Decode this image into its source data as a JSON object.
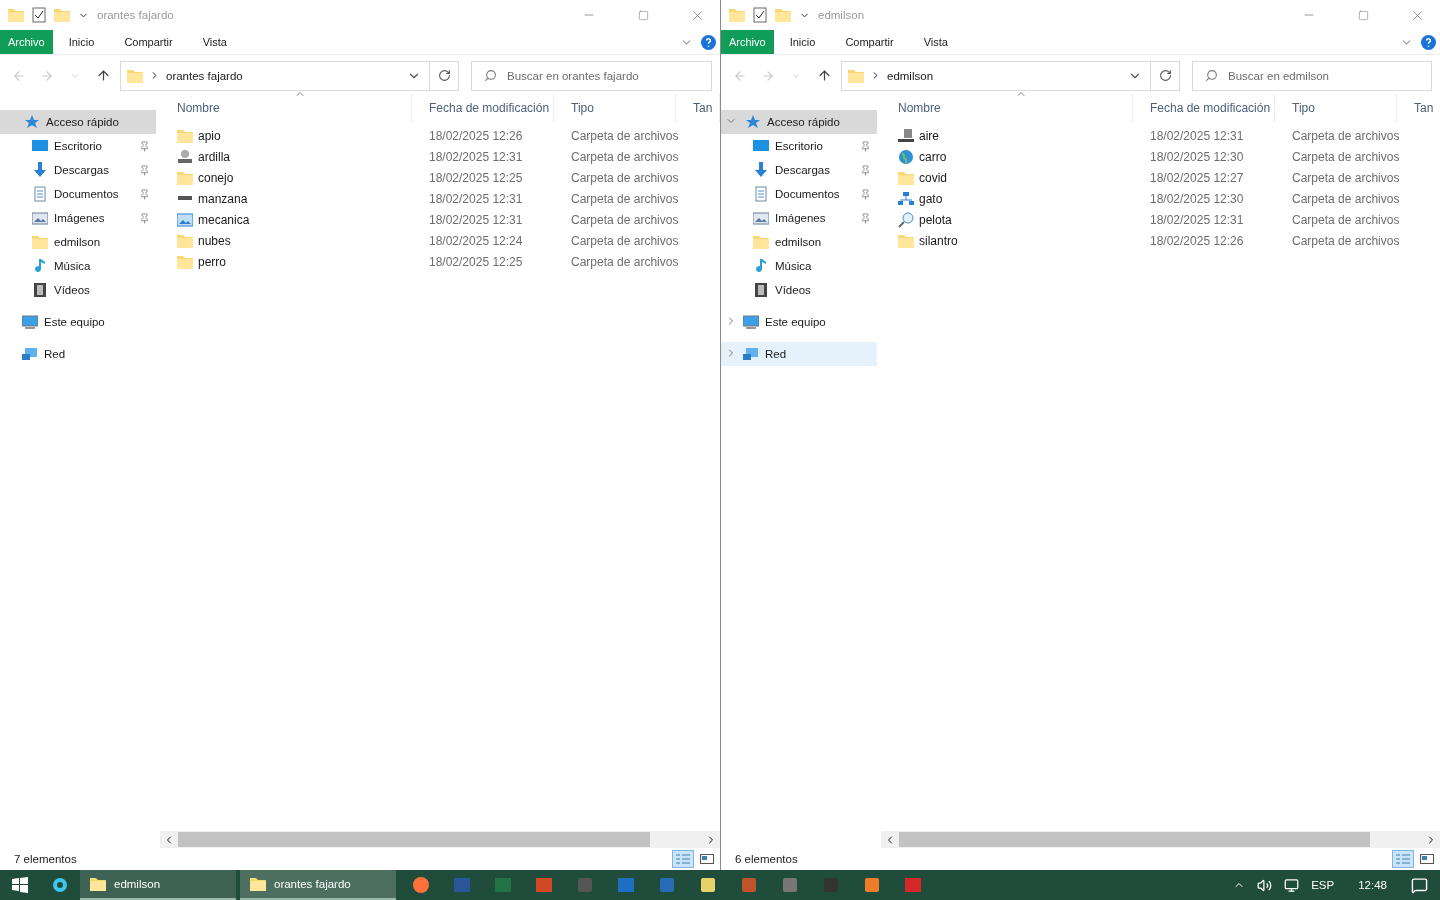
{
  "windows": [
    {
      "title": "orantes fajardo",
      "ribbon_tabs": [
        {
          "label": "Archivo",
          "selected": true
        },
        {
          "label": "Inicio",
          "selected": false
        },
        {
          "label": "Compartir",
          "selected": false
        },
        {
          "label": "Vista",
          "selected": false
        }
      ],
      "address": "orantes fajardo",
      "search_placeholder": "Buscar en orantes fajardo",
      "columns": [
        "Nombre",
        "Fecha de modificación",
        "Tipo",
        "Tan"
      ],
      "nav": [
        {
          "label": "Acceso rápido",
          "kind": "quick",
          "selected": true,
          "children": [
            {
              "label": "Escritorio",
              "kind": "desktop",
              "pinned": true
            },
            {
              "label": "Descargas",
              "kind": "downloads",
              "pinned": true
            },
            {
              "label": "Documentos",
              "kind": "documents",
              "pinned": true
            },
            {
              "label": "Imágenes",
              "kind": "pictures",
              "pinned": true
            },
            {
              "label": "edmilson",
              "kind": "folder",
              "pinned": false
            },
            {
              "label": "Música",
              "kind": "music",
              "pinned": false
            },
            {
              "label": "Vídeos",
              "kind": "videos",
              "pinned": false
            }
          ]
        },
        {
          "label": "Este equipo",
          "kind": "computer",
          "selected": false
        },
        {
          "label": "Red",
          "kind": "network",
          "selected": false
        }
      ],
      "files": [
        {
          "name": "apio",
          "kind": "folder",
          "date": "18/02/2025 12:26",
          "type": "Carpeta de archivos"
        },
        {
          "name": "ardilla",
          "kind": "drive-user",
          "date": "18/02/2025 12:31",
          "type": "Carpeta de archivos"
        },
        {
          "name": "conejo",
          "kind": "folder",
          "date": "18/02/2025 12:25",
          "type": "Carpeta de archivos"
        },
        {
          "name": "manzana",
          "kind": "drive",
          "date": "18/02/2025 12:31",
          "type": "Carpeta de archivos"
        },
        {
          "name": "mecanica",
          "kind": "picture",
          "date": "18/02/2025 12:31",
          "type": "Carpeta de archivos"
        },
        {
          "name": "nubes",
          "kind": "folder",
          "date": "18/02/2025 12:24",
          "type": "Carpeta de archivos"
        },
        {
          "name": "perro",
          "kind": "folder",
          "date": "18/02/2025 12:25",
          "type": "Carpeta de archivos"
        }
      ],
      "status": "7 elementos",
      "details_view": true
    },
    {
      "title": "edmilson",
      "ribbon_tabs": [
        {
          "label": "Archivo",
          "selected": true
        },
        {
          "label": "Inicio",
          "selected": false
        },
        {
          "label": "Compartir",
          "selected": false
        },
        {
          "label": "Vista",
          "selected": false
        }
      ],
      "address": "edmilson",
      "search_placeholder": "Buscar en edmilson",
      "columns": [
        "Nombre",
        "Fecha de modificación",
        "Tipo",
        "Tan"
      ],
      "nav": [
        {
          "label": "Acceso rápido",
          "kind": "quick",
          "selected": true,
          "expanded": true,
          "hovered": false,
          "children": [
            {
              "label": "Escritorio",
              "kind": "desktop",
              "pinned": true
            },
            {
              "label": "Descargas",
              "kind": "downloads",
              "pinned": true
            },
            {
              "label": "Documentos",
              "kind": "documents",
              "pinned": true
            },
            {
              "label": "Imágenes",
              "kind": "pictures",
              "pinned": true
            },
            {
              "label": "edmilson",
              "kind": "folder",
              "pinned": false
            },
            {
              "label": "Música",
              "kind": "music",
              "pinned": false
            },
            {
              "label": "Vídeos",
              "kind": "videos",
              "pinned": false
            }
          ]
        },
        {
          "label": "Este equipo",
          "kind": "computer",
          "selected": false,
          "expanded": false,
          "hovered": false
        },
        {
          "label": "Red",
          "kind": "network",
          "selected": false,
          "expanded": false,
          "hovered": true
        }
      ],
      "files": [
        {
          "name": "aire",
          "kind": "server",
          "date": "18/02/2025 12:31",
          "type": "Carpeta de archivos"
        },
        {
          "name": "carro",
          "kind": "globe",
          "date": "18/02/2025 12:30",
          "type": "Carpeta de archivos"
        },
        {
          "name": "covid",
          "kind": "folder",
          "date": "18/02/2025 12:27",
          "type": "Carpeta de archivos"
        },
        {
          "name": "gato",
          "kind": "network",
          "date": "18/02/2025 12:30",
          "type": "Carpeta de archivos"
        },
        {
          "name": "pelota",
          "kind": "search",
          "date": "18/02/2025 12:31",
          "type": "Carpeta de archivos"
        },
        {
          "name": "silantro",
          "kind": "folder",
          "date": "18/02/2025 12:26",
          "type": "Carpeta de archivos"
        }
      ],
      "status": "6 elementos",
      "details_view": true
    }
  ],
  "taskbar": {
    "windows": [
      {
        "label": "edmilson",
        "selected": false
      },
      {
        "label": "orantes fajardo",
        "selected": true
      }
    ],
    "apps": [
      {
        "kind": "browser",
        "color": "#ff7139"
      },
      {
        "kind": "doc",
        "color": "#2b579a"
      },
      {
        "kind": "doc",
        "color": "#217346"
      },
      {
        "kind": "doc",
        "color": "#d24726"
      },
      {
        "kind": "tile",
        "color": "#555555"
      },
      {
        "kind": "doc",
        "color": "#1e6fc4"
      },
      {
        "kind": "tile",
        "color": "#2a6bb5"
      },
      {
        "kind": "tile",
        "color": "#e8d36a"
      },
      {
        "kind": "tile",
        "color": "#c0532a"
      },
      {
        "kind": "tile",
        "color": "#777777"
      },
      {
        "kind": "tile",
        "color": "#333333"
      },
      {
        "kind": "tile",
        "color": "#f07b2b"
      },
      {
        "kind": "doc",
        "color": "#d62828"
      }
    ],
    "language": "ESP",
    "time": "12:48"
  }
}
